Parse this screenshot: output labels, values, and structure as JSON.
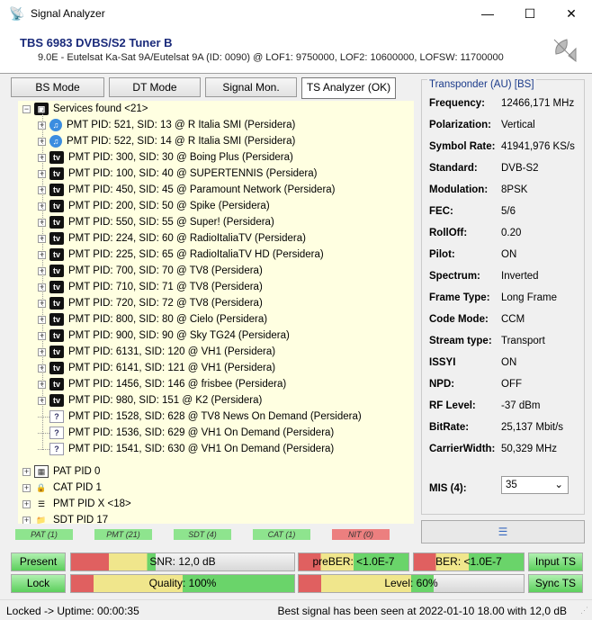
{
  "window": {
    "title": "Signal Analyzer",
    "minimize": "—",
    "maximize": "☐",
    "close": "✕"
  },
  "header": {
    "title": "TBS 6983 DVBS/S2 Tuner B",
    "subtitle": "9.0E - Eutelsat Ka-Sat 9A/Eutelsat 9A (ID: 0090) @ LOF1: 9750000, LOF2: 10600000, LOFSW: 11700000"
  },
  "tabs": [
    "BS Mode",
    "DT Mode",
    "Signal Mon.",
    "TS Analyzer (OK)"
  ],
  "tree": {
    "root": "Services found <21>",
    "services": [
      {
        "icon": "radio",
        "label": "PMT PID: 521, SID: 13 @ R Italia SMI (Persidera)"
      },
      {
        "icon": "radio",
        "label": "PMT PID: 522, SID: 14 @ R Italia SMI (Persidera)"
      },
      {
        "icon": "tv",
        "label": "PMT PID: 300, SID: 30 @ Boing Plus (Persidera)"
      },
      {
        "icon": "tv",
        "label": "PMT PID: 100, SID: 40 @ SUPERTENNIS (Persidera)"
      },
      {
        "icon": "tv",
        "label": "PMT PID: 450, SID: 45 @ Paramount Network (Persidera)"
      },
      {
        "icon": "tv",
        "label": "PMT PID: 200, SID: 50 @ Spike (Persidera)"
      },
      {
        "icon": "tv",
        "label": "PMT PID: 550, SID: 55 @ Super! (Persidera)"
      },
      {
        "icon": "tv",
        "label": "PMT PID: 224, SID: 60 @ RadioItaliaTV (Persidera)"
      },
      {
        "icon": "tv",
        "label": "PMT PID: 225, SID: 65 @ RadioItaliaTV HD (Persidera)"
      },
      {
        "icon": "tv",
        "label": "PMT PID: 700, SID: 70 @ TV8 (Persidera)"
      },
      {
        "icon": "tv",
        "label": "PMT PID: 710, SID: 71 @ TV8 (Persidera)"
      },
      {
        "icon": "tv",
        "label": "PMT PID: 720, SID: 72 @ TV8 (Persidera)"
      },
      {
        "icon": "tv",
        "label": "PMT PID: 800, SID: 80 @ Cielo (Persidera)"
      },
      {
        "icon": "tv",
        "label": "PMT PID: 900, SID: 90 @ Sky TG24 (Persidera)"
      },
      {
        "icon": "tv",
        "label": "PMT PID: 6131, SID: 120 @ VH1 (Persidera)"
      },
      {
        "icon": "tv",
        "label": "PMT PID: 6141, SID: 121 @ VH1 (Persidera)"
      },
      {
        "icon": "tv",
        "label": "PMT PID: 1456, SID: 146 @ frisbee (Persidera)"
      },
      {
        "icon": "tv",
        "label": "PMT PID: 980, SID: 151 @ K2 (Persidera)"
      },
      {
        "icon": "unknown",
        "label": "PMT PID: 1528, SID: 628 @ TV8 News On Demand (Persidera)"
      },
      {
        "icon": "unknown",
        "label": "PMT PID: 1536, SID: 629 @ VH1 On Demand (Persidera)"
      },
      {
        "icon": "unknown",
        "label": "PMT PID: 1541, SID: 630 @ VH1 On Demand (Persidera)"
      }
    ],
    "tables": [
      {
        "icon": "table",
        "label": "PAT PID 0"
      },
      {
        "icon": "lock",
        "label": "CAT PID 1"
      },
      {
        "icon": "list",
        "label": "PMT PID X <18>"
      },
      {
        "icon": "folder",
        "label": "SDT PID 17"
      }
    ]
  },
  "transponder": {
    "legend": "Transponder (AU) [BS]",
    "rows": [
      {
        "label": "Frequency:",
        "value": "12466,171 MHz"
      },
      {
        "label": "Polarization:",
        "value": "Vertical"
      },
      {
        "label": "Symbol Rate:",
        "value": "41941,976 KS/s"
      },
      {
        "label": "Standard:",
        "value": "DVB-S2"
      },
      {
        "label": "Modulation:",
        "value": "8PSK"
      },
      {
        "label": "FEC:",
        "value": "5/6"
      },
      {
        "label": "RollOff:",
        "value": "0.20"
      },
      {
        "label": "Pilot:",
        "value": "ON"
      },
      {
        "label": "Spectrum:",
        "value": "Inverted"
      },
      {
        "label": "Frame Type:",
        "value": "Long Frame"
      },
      {
        "label": "Code Mode:",
        "value": "CCM"
      },
      {
        "label": "Stream type:",
        "value": "Transport"
      },
      {
        "label": "ISSYI",
        "value": "ON"
      },
      {
        "label": "NPD:",
        "value": "OFF"
      },
      {
        "label": "RF Level:",
        "value": "-37 dBm"
      },
      {
        "label": "BitRate:",
        "value": "25,137 Mbit/s"
      },
      {
        "label": "CarrierWidth:",
        "value": "50,329 MHz"
      }
    ],
    "mis_label": "MIS (4):",
    "mis_value": "35"
  },
  "table_indicators": [
    {
      "label": "PAT (1)",
      "color": "#8ee48e"
    },
    {
      "label": "PMT (21)",
      "color": "#8ee48e"
    },
    {
      "label": "SDT (4)",
      "color": "#8ee48e"
    },
    {
      "label": "CAT (1)",
      "color": "#8ee48e"
    },
    {
      "label": "NIT (0)",
      "color": "#ec7f7f"
    }
  ],
  "indicators": {
    "present": "Present",
    "lock": "Lock",
    "input_ts": "Input TS",
    "sync_ts": "Sync TS"
  },
  "meters": {
    "snr": {
      "label": "SNR: 12,0 dB",
      "fill": 0.38
    },
    "quality": {
      "label": "Quality: 100%",
      "fill": 1.0
    },
    "preber": {
      "label": "preBER: <1.0E-7",
      "fill": 1.0
    },
    "ber": {
      "label": "BER: <1.0E-7",
      "fill": 1.0
    },
    "level": {
      "label": "Level: 60%",
      "fill": 0.6
    }
  },
  "status": {
    "left": "Locked -> Uptime: 00:00:35",
    "right": "Best signal has been seen at 2022-01-10 18.00 with 12,0 dB"
  }
}
